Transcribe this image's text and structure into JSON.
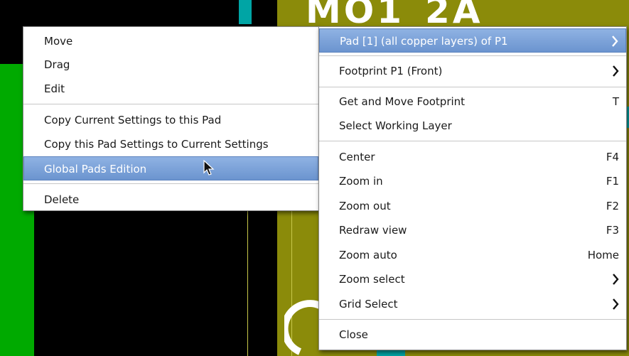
{
  "canvas": {
    "pcb_label": "MO1_2A",
    "colors": {
      "background": "#000000",
      "copper": "#8b8b0a",
      "track": "#00aa00",
      "via": "#00a5a5",
      "selection": "#6b94cf"
    }
  },
  "left_menu": {
    "items": [
      {
        "label": "Move"
      },
      {
        "label": "Drag"
      },
      {
        "label": "Edit"
      },
      {
        "label": "Copy Current Settings to this Pad"
      },
      {
        "label": "Copy this Pad Settings to Current Settings"
      },
      {
        "label": "Global Pads Edition",
        "selected": true
      },
      {
        "label": "Delete"
      }
    ]
  },
  "right_menu": {
    "items": [
      {
        "label": "Pad [1] (all copper layers) of P1",
        "submenu": true,
        "selected": true
      },
      {
        "label": "Footprint P1 (Front)",
        "submenu": true
      },
      {
        "label": "Get and Move Footprint",
        "accel": "T"
      },
      {
        "label": "Select Working Layer"
      },
      {
        "label": "Center",
        "accel": "F4"
      },
      {
        "label": "Zoom in",
        "accel": "F1"
      },
      {
        "label": "Zoom out",
        "accel": "F2"
      },
      {
        "label": "Redraw view",
        "accel": "F3"
      },
      {
        "label": "Zoom auto",
        "accel": "Home"
      },
      {
        "label": "Zoom select",
        "submenu": true
      },
      {
        "label": "Grid Select",
        "submenu": true
      },
      {
        "label": "Close"
      }
    ]
  },
  "icons": {
    "submenu_arrow": "chevron-right-icon",
    "pointer": "mouse-pointer-icon"
  }
}
